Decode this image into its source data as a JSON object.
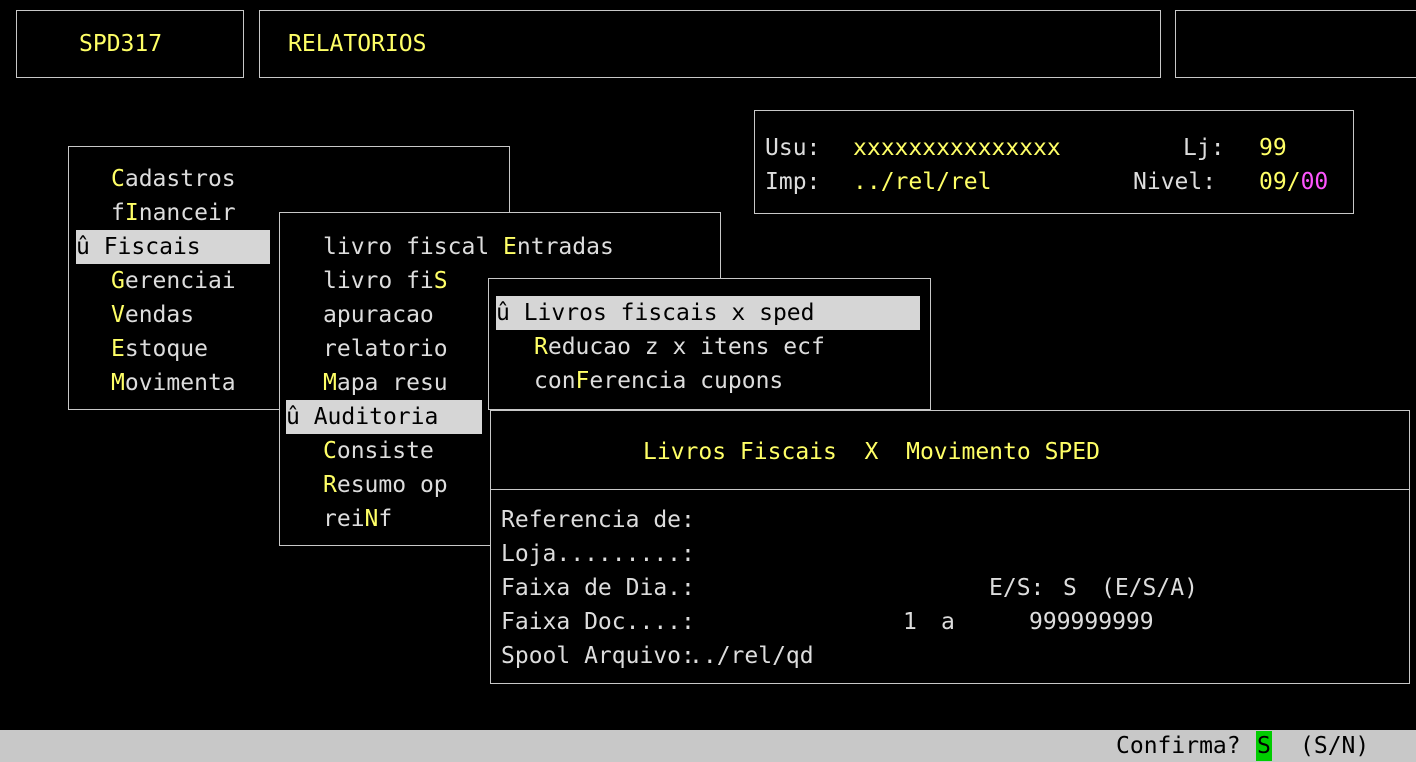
{
  "header": {
    "program_code": "SPD317",
    "screen_title": "RELATORIOS"
  },
  "user_info": {
    "user_label": "Usu:",
    "user_value": "xxxxxxxxxxxxxxx",
    "store_label": "Lj:",
    "store_value": "99",
    "printer_label": "Imp:",
    "printer_value": "../rel/rel",
    "level_label": "Nivel:",
    "level_value": "09",
    "level_sep": "/",
    "level_value2": "00"
  },
  "main_menu": {
    "items": [
      {
        "pre": "",
        "hot": "C",
        "post": "adastros"
      },
      {
        "pre": "f",
        "hot": "I",
        "post": "nanceir"
      },
      {
        "marker": "û ",
        "pre": "",
        "hot": "",
        "post": "Fiscais",
        "selected": true
      },
      {
        "pre": "",
        "hot": "G",
        "post": "erenciai"
      },
      {
        "pre": "",
        "hot": "V",
        "post": "endas"
      },
      {
        "pre": "",
        "hot": "E",
        "post": "stoque"
      },
      {
        "pre": "",
        "hot": "M",
        "post": "ovimenta"
      }
    ]
  },
  "fiscal_menu": {
    "items": [
      {
        "pre": "livro fiscal ",
        "hot": "E",
        "post": "ntradas"
      },
      {
        "pre": "livro fi",
        "hot": "S",
        "post": ""
      },
      {
        "pre": "apuracao",
        "hot": "",
        "post": ""
      },
      {
        "pre": "relatorio",
        "hot": "",
        "post": ""
      },
      {
        "pre": "",
        "hot": "M",
        "post": "apa resu"
      },
      {
        "marker": "û ",
        "pre": "",
        "hot": "",
        "post": "Auditoria",
        "selected": true
      },
      {
        "pre": "",
        "hot": "C",
        "post": "onsiste"
      },
      {
        "pre": "",
        "hot": "R",
        "post": "esumo op"
      },
      {
        "pre": "rei",
        "hot": "N",
        "post": "f"
      }
    ]
  },
  "audit_menu": {
    "items": [
      {
        "marker": "û ",
        "pre": "",
        "hot": "",
        "post": "Livros fiscais x sped",
        "selected": true
      },
      {
        "pre": "",
        "hot": "R",
        "post": "educao z x itens ecf"
      },
      {
        "pre": "con",
        "hot": "F",
        "post": "erencia cupons"
      }
    ]
  },
  "dialog": {
    "title": "Livros Fiscais  X  Movimento SPED",
    "fields": {
      "referencia_label": "Referencia de:",
      "loja_label": "Loja.........:",
      "faixa_dia_label": "Faixa de Dia.:",
      "es_label": "E/S:",
      "es_value": "S",
      "es_options": "(E/S/A)",
      "faixa_doc_label": "Faixa Doc....:",
      "doc_from": "1",
      "doc_sep": "a",
      "doc_to": "999999999",
      "spool_label": "Spool Arquivo:",
      "spool_value": "../rel/qd"
    }
  },
  "status_bar": {
    "prompt": "Confirma?",
    "answer": "S",
    "options": "(S/N)"
  },
  "colors": {
    "background": "#000000",
    "text": "#dddddd",
    "highlight": "#ffff66",
    "magenta": "#ff55ff",
    "selection_bg": "#d6d6d6",
    "status_bar_bg": "#c8c8c8",
    "answer_bg": "#00cc00"
  }
}
